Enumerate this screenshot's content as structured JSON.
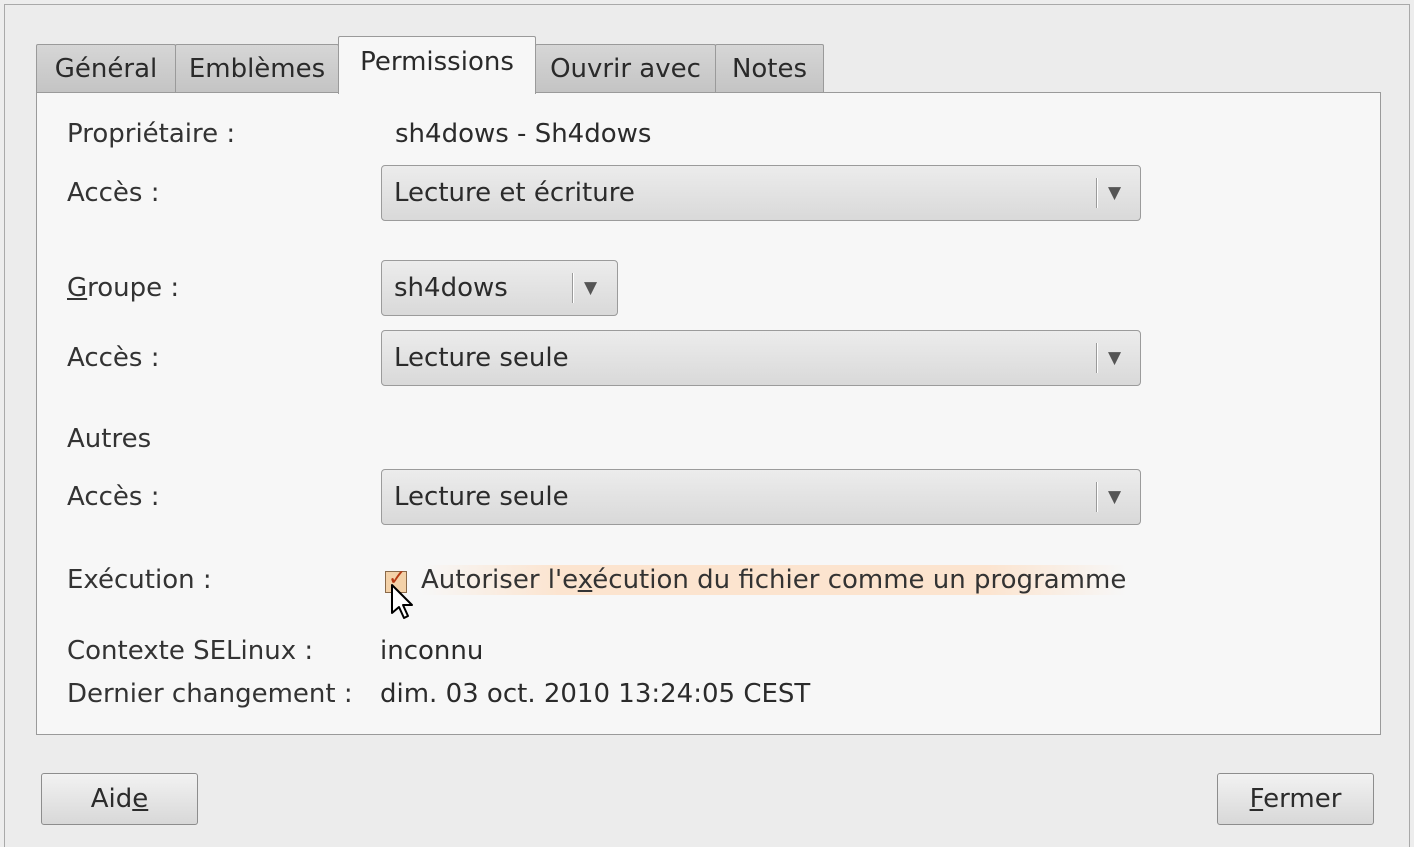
{
  "tabs": [
    {
      "label": "Général"
    },
    {
      "label": "Emblèmes"
    },
    {
      "label": "Permissions"
    },
    {
      "label": "Ouvrir avec"
    },
    {
      "label": "Notes"
    }
  ],
  "active_tab": "Permissions",
  "owner": {
    "label": "Propriétaire :",
    "value": "sh4dows - Sh4dows",
    "access_label": "Accès :",
    "access_value": "Lecture et écriture"
  },
  "group": {
    "label_prefix": "G",
    "label_rest": "roupe :",
    "value": "sh4dows",
    "access_label": "Accès :",
    "access_value": "Lecture seule"
  },
  "others": {
    "label": "Autres",
    "access_label": "Accès :",
    "access_value": "Lecture seule"
  },
  "execution": {
    "label": "Exécution :",
    "checkbox_checked": true,
    "checkbox_label_part1": "Autoriser l'e",
    "checkbox_label_mnemonic": "x",
    "checkbox_label_part2": "écution du fichier comme un programme"
  },
  "selinux": {
    "label": "Contexte SELinux :",
    "value": "inconnu"
  },
  "last_change": {
    "label": "Dernier changement :",
    "value": "dim. 03 oct. 2010 13:24:05 CEST"
  },
  "buttons": {
    "help_part1": "Aid",
    "help_mnemonic": "e",
    "close_mnemonic": "F",
    "close_rest": "ermer"
  },
  "icons": {
    "dropdown": "triangle-down-icon",
    "cursor": "mouse-pointer-icon"
  }
}
